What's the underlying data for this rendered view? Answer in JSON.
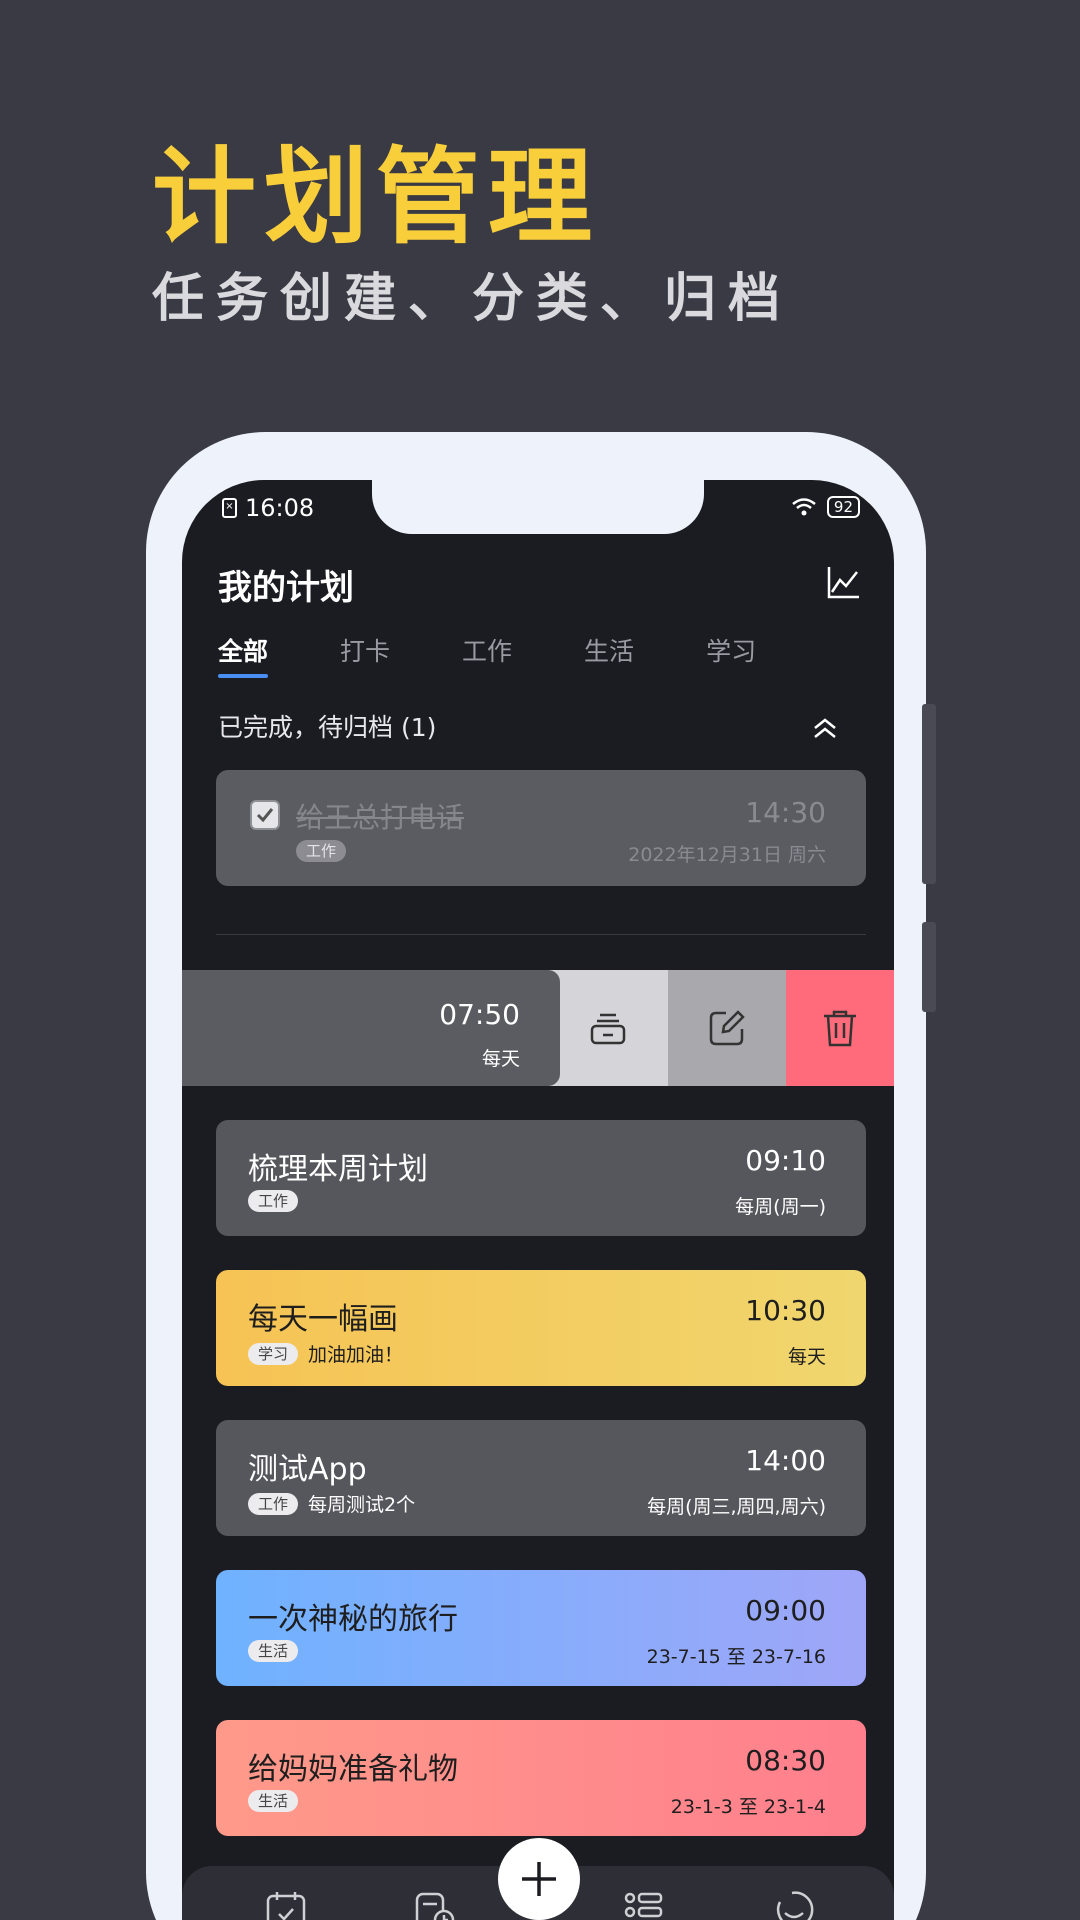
{
  "promo": {
    "title": "计划管理",
    "subtitle": "任务创建、分类、归档"
  },
  "status_bar": {
    "time": "16:08",
    "battery": "92"
  },
  "header": {
    "title": "我的计划",
    "chart_icon": "line-chart-icon"
  },
  "tabs": [
    {
      "label": "全部",
      "active": true
    },
    {
      "label": "打卡",
      "active": false
    },
    {
      "label": "工作",
      "active": false
    },
    {
      "label": "生活",
      "active": false
    },
    {
      "label": "学习",
      "active": false
    }
  ],
  "completed_section": {
    "label": "已完成，待归档 (1)",
    "item": {
      "title": "给王总打电话",
      "tag": "工作",
      "time": "14:30",
      "date": "2022年12月31日 周六",
      "checked": true
    }
  },
  "swiped_item": {
    "time": "07:50",
    "repeat": "每天",
    "actions": {
      "archive_icon": "archive-icon",
      "edit_icon": "edit-icon",
      "delete_icon": "trash-icon"
    }
  },
  "plans": [
    {
      "title": "梳理本周计划",
      "tag": "工作",
      "note": "",
      "time": "09:10",
      "repeat": "每周(周一)",
      "style": "gray"
    },
    {
      "title": "每天一幅画",
      "tag": "学习",
      "note": "加油加油！",
      "time": "10:30",
      "repeat": "每天",
      "style": "yellow"
    },
    {
      "title": "测试App",
      "tag": "工作",
      "note": "每周测试2个",
      "time": "14:00",
      "repeat": "每周(周三,周四,周六)",
      "style": "gray"
    },
    {
      "title": "一次神秘的旅行",
      "tag": "生活",
      "note": "",
      "time": "09:00",
      "repeat": "23-7-15 至 23-7-16",
      "style": "blue"
    },
    {
      "title": "给妈妈准备礼物",
      "tag": "生活",
      "note": "",
      "time": "08:30",
      "repeat": "23-1-3 至 23-1-4",
      "style": "pink"
    }
  ],
  "colors": {
    "background": "#3a3a44",
    "title_yellow": "#f8cf3a",
    "accent_blue": "#4a8ef2",
    "delete_red": "#ff6b7a"
  }
}
